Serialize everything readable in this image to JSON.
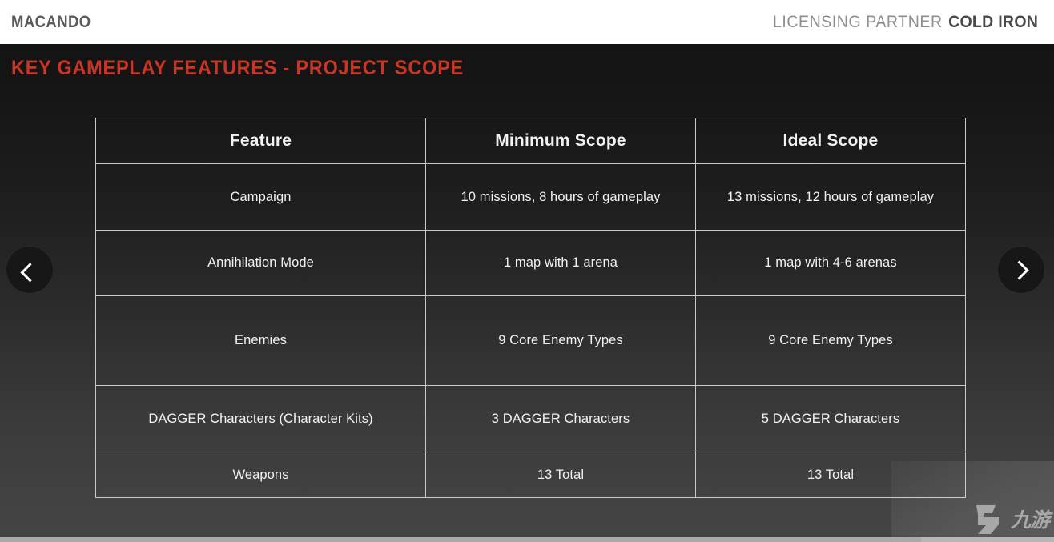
{
  "header": {
    "brand": "MACANDO",
    "partner_label": "LICENSING PARTNER",
    "partner_name": "COLD IRON"
  },
  "slide": {
    "title": "KEY GAMEPLAY FEATURES - PROJECT SCOPE",
    "title_color": "#cc3526"
  },
  "table": {
    "columns": [
      "Feature",
      "Minimum Scope",
      "Ideal Scope"
    ],
    "rows": [
      {
        "feature": "Campaign",
        "minimum": "10 missions, 8 hours of gameplay",
        "ideal": "13 missions, 12 hours of gameplay"
      },
      {
        "feature": "Annihilation Mode",
        "minimum": "1 map with 1 arena",
        "ideal": "1 map with 4-6 arenas"
      },
      {
        "feature": "Enemies",
        "minimum": "9 Core Enemy Types",
        "ideal": "9 Core Enemy Types"
      },
      {
        "feature": "DAGGER Characters (Character Kits)",
        "minimum": "3 DAGGER Characters",
        "ideal": "5 DAGGER Characters"
      },
      {
        "feature": "Weapons",
        "minimum": "13 Total",
        "ideal": "13 Total"
      }
    ]
  },
  "navigation": {
    "prev_icon": "chevron-left-icon",
    "next_icon": "chevron-right-icon"
  },
  "watermark": {
    "text": "九游",
    "mark": "nine-game-logo-icon"
  }
}
